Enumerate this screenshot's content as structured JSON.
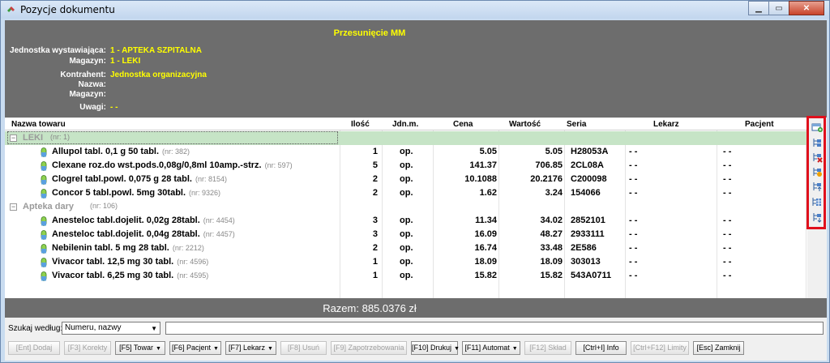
{
  "window": {
    "title": "Pozycje dokumentu"
  },
  "header": {
    "doc_type": "Przesunięcie MM",
    "fields": [
      {
        "label": "Jednostka wystawiająca:",
        "value": "1 - APTEKA SZPITALNA"
      },
      {
        "label": "Magazyn:",
        "value": "1 - LEKI"
      },
      {
        "label": "Kontrahent:",
        "value": "Jednostka organizacyjna"
      },
      {
        "label": "Nazwa:",
        "value": ""
      },
      {
        "label": "Magazyn:",
        "value": ""
      },
      {
        "label": "Uwagi:",
        "value": "- -"
      }
    ]
  },
  "grid": {
    "columns": [
      "Nazwa towaru",
      "Ilość",
      "Jdn.m.",
      "Cena",
      "Wartość",
      "Seria",
      "Lekarz",
      "Pacjent"
    ],
    "groups": [
      {
        "name": "LEKI",
        "nr": "(nr: 1)",
        "items": [
          {
            "name": "Allupol tabl. 0,1 g 50 tabl.",
            "nr": "(nr: 382)",
            "qty": "1",
            "unit": "op.",
            "price": "5.05",
            "value": "5.05",
            "series": "H28053A",
            "doctor": "- -",
            "patient": "- -"
          },
          {
            "name": "Clexane roz.do wst.pods.0,08g/0,8ml 10amp.-strz.",
            "nr": "(nr: 597)",
            "qty": "5",
            "unit": "op.",
            "price": "141.37",
            "value": "706.85",
            "series": "2CL08A",
            "doctor": "- -",
            "patient": "- -"
          },
          {
            "name": "Clogrel tabl.powl. 0,075 g 28 tabl.",
            "nr": "(nr: 8154)",
            "qty": "2",
            "unit": "op.",
            "price": "10.1088",
            "value": "20.2176",
            "series": "C200098",
            "doctor": "- -",
            "patient": "- -"
          },
          {
            "name": "Concor 5 tabl.powl. 5mg 30tabl.",
            "nr": "(nr: 9326)",
            "qty": "2",
            "unit": "op.",
            "price": "1.62",
            "value": "3.24",
            "series": "154066",
            "doctor": "- -",
            "patient": "- -"
          }
        ]
      },
      {
        "name": "Apteka dary",
        "nr": "(nr: 106)",
        "items": [
          {
            "name": "Anesteloc tabl.dojelit. 0,02g 28tabl.",
            "nr": "(nr: 4454)",
            "qty": "3",
            "unit": "op.",
            "price": "11.34",
            "value": "34.02",
            "series": "2852101",
            "doctor": "- -",
            "patient": "- -"
          },
          {
            "name": "Anesteloc tabl.dojelit. 0,04g 28tabl.",
            "nr": "(nr: 4457)",
            "qty": "3",
            "unit": "op.",
            "price": "16.09",
            "value": "48.27",
            "series": "2933111",
            "doctor": "- -",
            "patient": "- -"
          },
          {
            "name": "Nebilenin tabl. 5 mg 28 tabl.",
            "nr": "(nr: 2212)",
            "qty": "2",
            "unit": "op.",
            "price": "16.74",
            "value": "33.48",
            "series": "2E586",
            "doctor": "- -",
            "patient": "- -"
          },
          {
            "name": "Vivacor tabl. 12,5 mg 30 tabl.",
            "nr": "(nr: 4596)",
            "qty": "1",
            "unit": "op.",
            "price": "18.09",
            "value": "18.09",
            "series": "303013",
            "doctor": "- -",
            "patient": "- -"
          },
          {
            "name": "Vivacor tabl. 6,25 mg 30 tabl.",
            "nr": "(nr: 4595)",
            "qty": "1",
            "unit": "op.",
            "price": "15.82",
            "value": "15.82",
            "series": "543A0711",
            "doctor": "- -",
            "patient": "- -"
          }
        ]
      }
    ]
  },
  "total": "Razem: 885.0376 zł",
  "search": {
    "label": "Szukaj według:",
    "selected": "Numeru, nazwy",
    "value": ""
  },
  "buttons": [
    {
      "label": "[Ent] Dodaj",
      "enabled": false,
      "dropdown": false
    },
    {
      "label": "[F3] Korekty",
      "enabled": false,
      "dropdown": false
    },
    {
      "label": "[F5] Towar",
      "enabled": true,
      "dropdown": true
    },
    {
      "label": "[F6] Pacjent",
      "enabled": true,
      "dropdown": true
    },
    {
      "label": "[F7] Lekarz",
      "enabled": true,
      "dropdown": true
    },
    {
      "label": "[F8] Usuń",
      "enabled": false,
      "dropdown": false
    },
    {
      "label": "[F9] Zapotrzebowania",
      "enabled": false,
      "dropdown": false
    },
    {
      "label": "[F10] Drukuj",
      "enabled": true,
      "dropdown": true
    },
    {
      "label": "[F11] Automat",
      "enabled": true,
      "dropdown": true
    },
    {
      "label": "[F12] Skład",
      "enabled": false,
      "dropdown": false
    },
    {
      "label": "[Ctrl+I] Info",
      "enabled": true,
      "dropdown": false
    },
    {
      "label": "[Ctrl+F12] Limity",
      "enabled": false,
      "dropdown": false
    },
    {
      "label": "[Esc] Zamknij",
      "enabled": true,
      "dropdown": false
    }
  ],
  "side_toolbar": [
    "add-row-icon",
    "tree-expand-icon",
    "tree-delete-icon",
    "tree-add-icon",
    "tree-up-icon",
    "tree-grid-icon",
    "tree-move-icon"
  ],
  "colors": {
    "header_bg": "#6d6d6d",
    "header_value": "#ffff00",
    "selection": "#c6e4c6",
    "highlight_border": "#e0101c"
  }
}
